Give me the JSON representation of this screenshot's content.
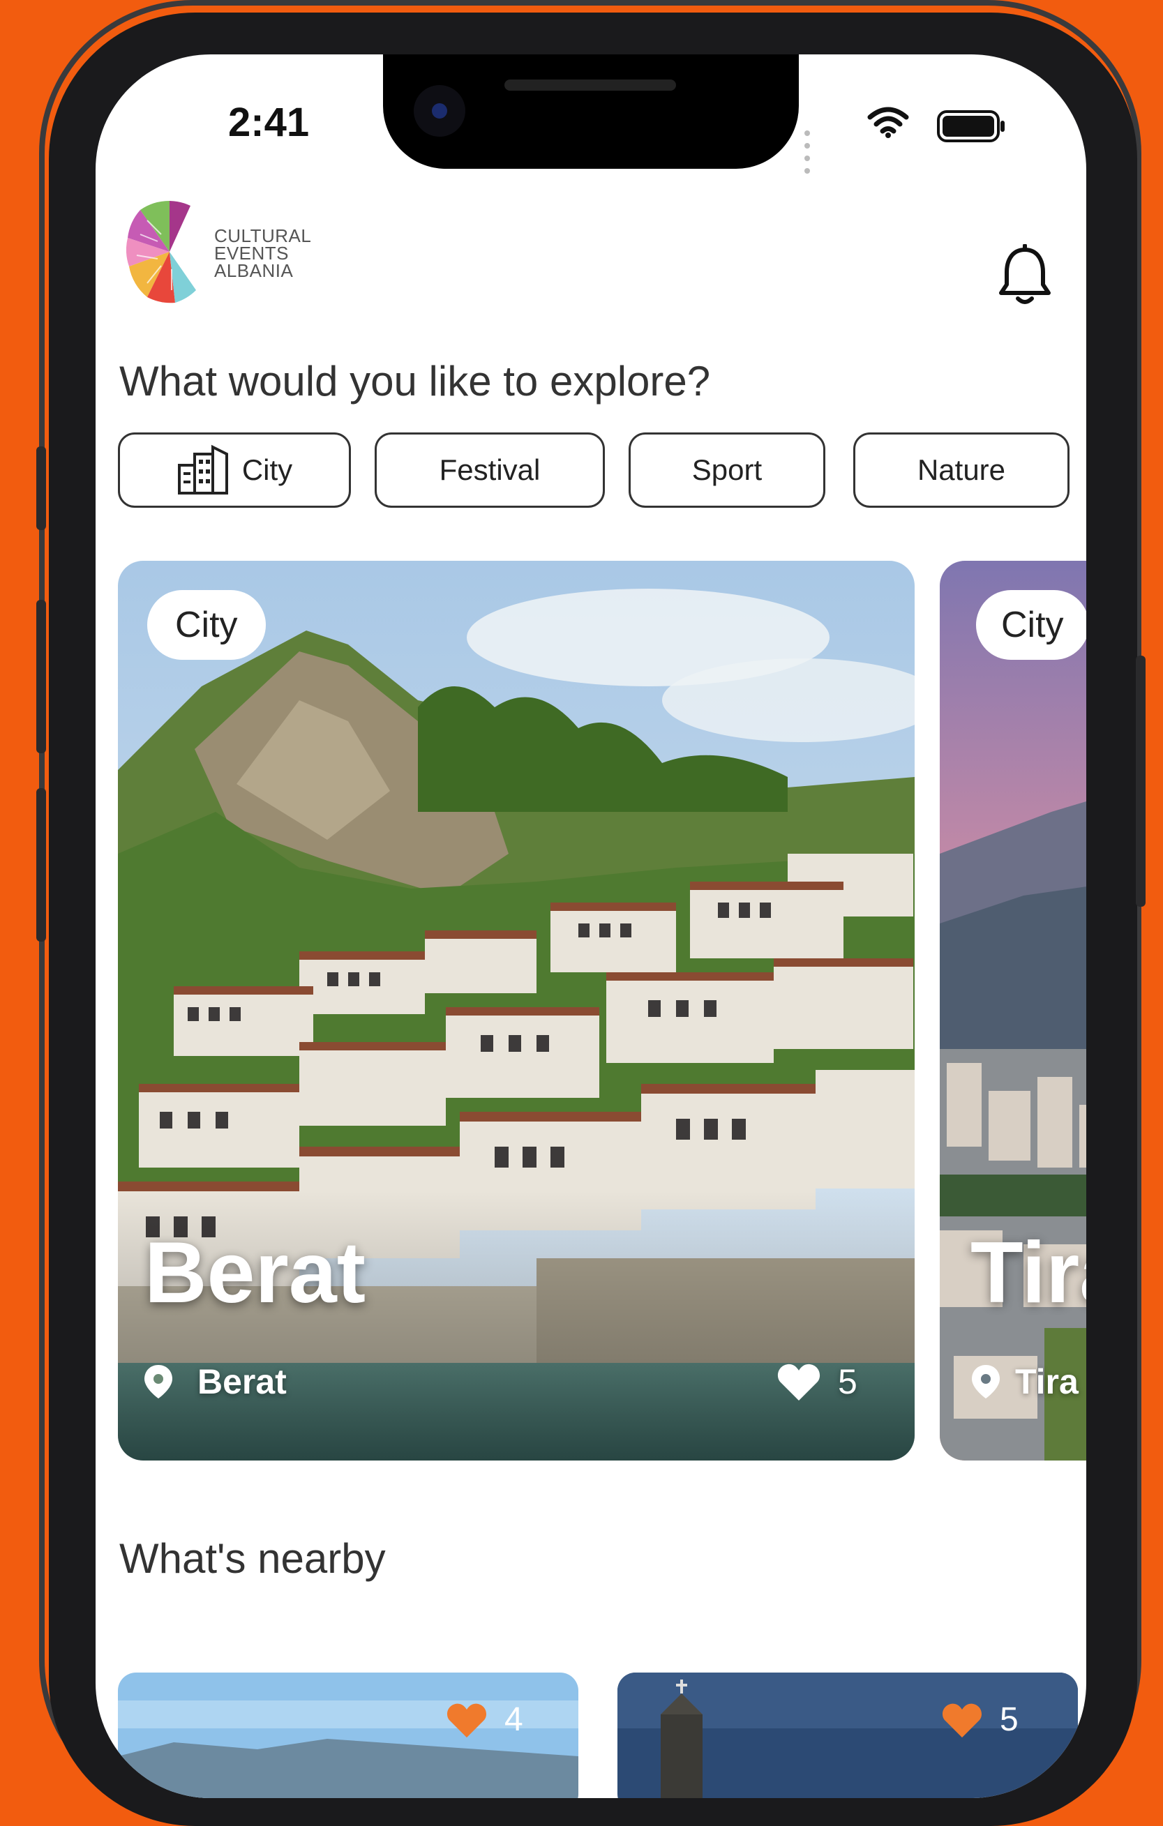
{
  "status_bar": {
    "time": "2:41"
  },
  "brand": {
    "logo_line1": "CULTURAL",
    "logo_line2": "EVENTS",
    "logo_line3": "ALBANIA"
  },
  "explore": {
    "title": "What would you like to explore?",
    "categories": [
      {
        "label": "City",
        "icon": "building-icon"
      },
      {
        "label": "Festival"
      },
      {
        "label": "Sport"
      },
      {
        "label": "Nature"
      }
    ]
  },
  "featured": [
    {
      "badge": "City",
      "title": "Berat",
      "location": "Berat",
      "likes": "5"
    },
    {
      "badge": "City",
      "title": "Tira",
      "location": "Tira"
    }
  ],
  "nearby": {
    "title": "What's nearby",
    "items": [
      {
        "likes": "4"
      },
      {
        "likes": "5"
      }
    ]
  },
  "colors": {
    "brand_orange": "#f25c0f",
    "heart_orange": "#f07a2c"
  }
}
